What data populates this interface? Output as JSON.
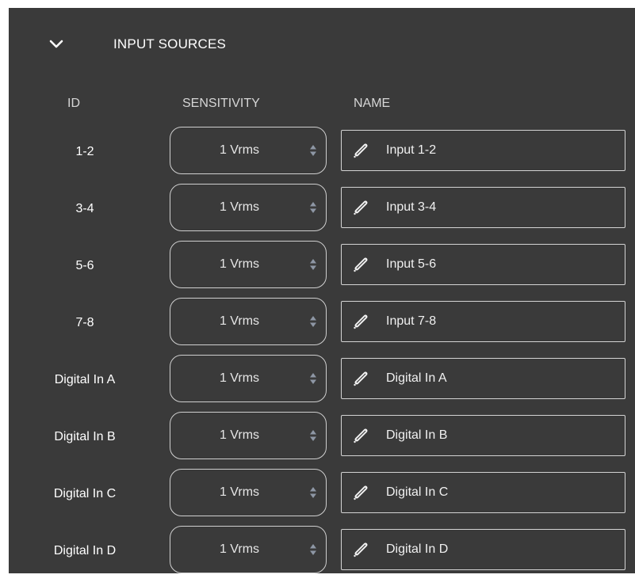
{
  "section": {
    "title": "INPUT SOURCES",
    "collapse_icon": "chevron-down-icon"
  },
  "columns": {
    "id": "ID",
    "sensitivity": "SENSITIVITY",
    "name": "NAME"
  },
  "icons": {
    "select_arrows": "up-down-arrows-icon",
    "edit": "pencil-icon"
  },
  "rows": [
    {
      "id": "1-2",
      "sensitivity": "1 Vrms",
      "name": "Input 1-2"
    },
    {
      "id": "3-4",
      "sensitivity": "1 Vrms",
      "name": "Input 3-4"
    },
    {
      "id": "5-6",
      "sensitivity": "1 Vrms",
      "name": "Input 5-6"
    },
    {
      "id": "7-8",
      "sensitivity": "1 Vrms",
      "name": "Input 7-8"
    },
    {
      "id": "Digital In A",
      "sensitivity": "1 Vrms",
      "name": "Digital In A"
    },
    {
      "id": "Digital In B",
      "sensitivity": "1 Vrms",
      "name": "Digital In B"
    },
    {
      "id": "Digital In C",
      "sensitivity": "1 Vrms",
      "name": "Digital In C"
    },
    {
      "id": "Digital In D",
      "sensitivity": "1 Vrms",
      "name": "Digital In D"
    }
  ],
  "colors": {
    "panel_bg": "#3a3a3a",
    "text": "#ffffff",
    "border": "#cfcfcf",
    "arrow_icon": "#8e97a5"
  }
}
